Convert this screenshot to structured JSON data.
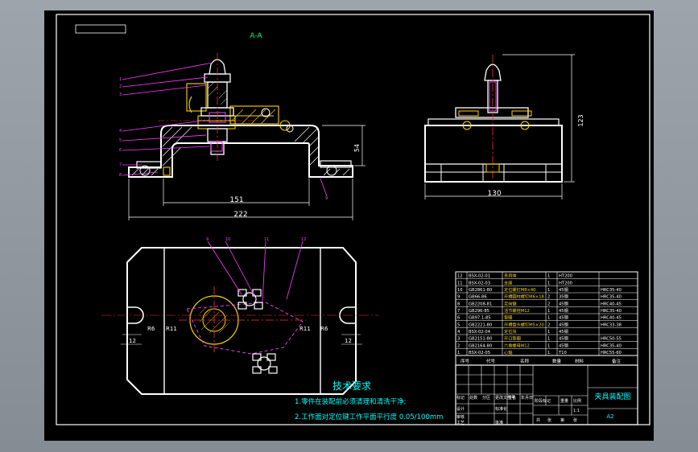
{
  "drawing": {
    "section_label": "A-A",
    "dimensions": {
      "front_width_inner": "151",
      "front_width_overall": "222",
      "front_height": "54",
      "side_width": "130",
      "side_height": "123",
      "plan_r_left_small": "R6",
      "plan_r_left": "R11",
      "plan_r_right": "R11",
      "plan_r_right_small": "R6",
      "plan_slot_left": "12",
      "plan_slot_right": "12"
    },
    "technical_requirements": {
      "title": "技术要求",
      "line1": "1.零件在装配前必须清理和清洗干净;",
      "line2": "2.工作面对定位键工作平面平行度 0.05/100mm"
    },
    "bom_rows": [
      {
        "no": "12",
        "code": "BSX-02-01",
        "name": "夹具体",
        "qty": "1",
        "material": "HT200",
        "note": ""
      },
      {
        "no": "11",
        "code": "BSX-02-03",
        "name": "支座",
        "qty": "1",
        "material": "HT200",
        "note": ""
      },
      {
        "no": "10",
        "code": "GB2861-80",
        "name": "定位螺钉M8×40",
        "qty": "1",
        "material": "45钢",
        "note": "HRC35-40"
      },
      {
        "no": "9",
        "code": "GB66-86",
        "name": "开槽圆柱螺钉M6×18",
        "qty": "2",
        "material": "35钢",
        "note": "HRC35-40"
      },
      {
        "no": "8",
        "code": "GB2208-81",
        "name": "定向键",
        "qty": "2",
        "material": "45钢",
        "note": "HRC40-45"
      },
      {
        "no": "7",
        "code": "GB296-85",
        "name": "活节螺栓M12",
        "qty": "1",
        "material": "45钢",
        "note": "HRC35-40"
      },
      {
        "no": "6",
        "code": "GB97.1-85",
        "name": "垫圈",
        "qty": "1",
        "material": "45钢",
        "note": "HRC40-45"
      },
      {
        "no": "5",
        "code": "GB2221-80",
        "name": "开槽盘头螺钉M5×20",
        "qty": "2",
        "material": "45钢",
        "note": "HRC33-38"
      },
      {
        "no": "4",
        "code": "BSX-02-04",
        "name": "定位块",
        "qty": "1",
        "material": "45钢",
        "note": ""
      },
      {
        "no": "3",
        "code": "GB2151-80",
        "name": "开口垫圈",
        "qty": "1",
        "material": "45钢",
        "note": "HRC50-55"
      },
      {
        "no": "2",
        "code": "GB2164-80",
        "name": "六角螺母M12",
        "qty": "1",
        "material": "45钢",
        "note": "HRC35-40"
      },
      {
        "no": "1",
        "code": "BSX-02-05",
        "name": "心轴",
        "qty": "1",
        "material": "T10",
        "note": "HRC55-60"
      }
    ],
    "bom_header": {
      "no": "序号",
      "code": "代号",
      "name": "名称",
      "qty": "数量",
      "material": "材料",
      "note": "备注"
    },
    "title_block": {
      "drawing_title": "夹具装配图",
      "sheet_size": "A2",
      "stage_label": "阶段标记",
      "weight_label": "重量",
      "scale_label": "比例",
      "scale_value": "1:1",
      "row_labels": [
        "标记",
        "处数",
        "分区",
        "更改文件号",
        "签名",
        "年月日"
      ],
      "designer_row": [
        "设计",
        "标准化"
      ],
      "check_row": [
        "审核"
      ],
      "process_row": [
        "工艺",
        "批准"
      ],
      "sheet_row": [
        "共",
        "张",
        "第",
        "张"
      ]
    },
    "callouts": [
      "1",
      "2",
      "3",
      "4",
      "5",
      "6",
      "7",
      "8",
      "9",
      "10",
      "11",
      "12"
    ]
  },
  "colors": {
    "background_outer": "#9a9fa6",
    "canvas": "#000000",
    "frame": "#ffffff",
    "outline": "#ffffff",
    "dimension": "#ffffff",
    "leader": "#ff40ff",
    "section_hatch": "#ffffff",
    "center_line": "#ff3030",
    "yellow_parts": "#ffd400",
    "cyan_text": "#00ffff",
    "green_text": "#00ff66",
    "table_line": "#ffffff"
  }
}
